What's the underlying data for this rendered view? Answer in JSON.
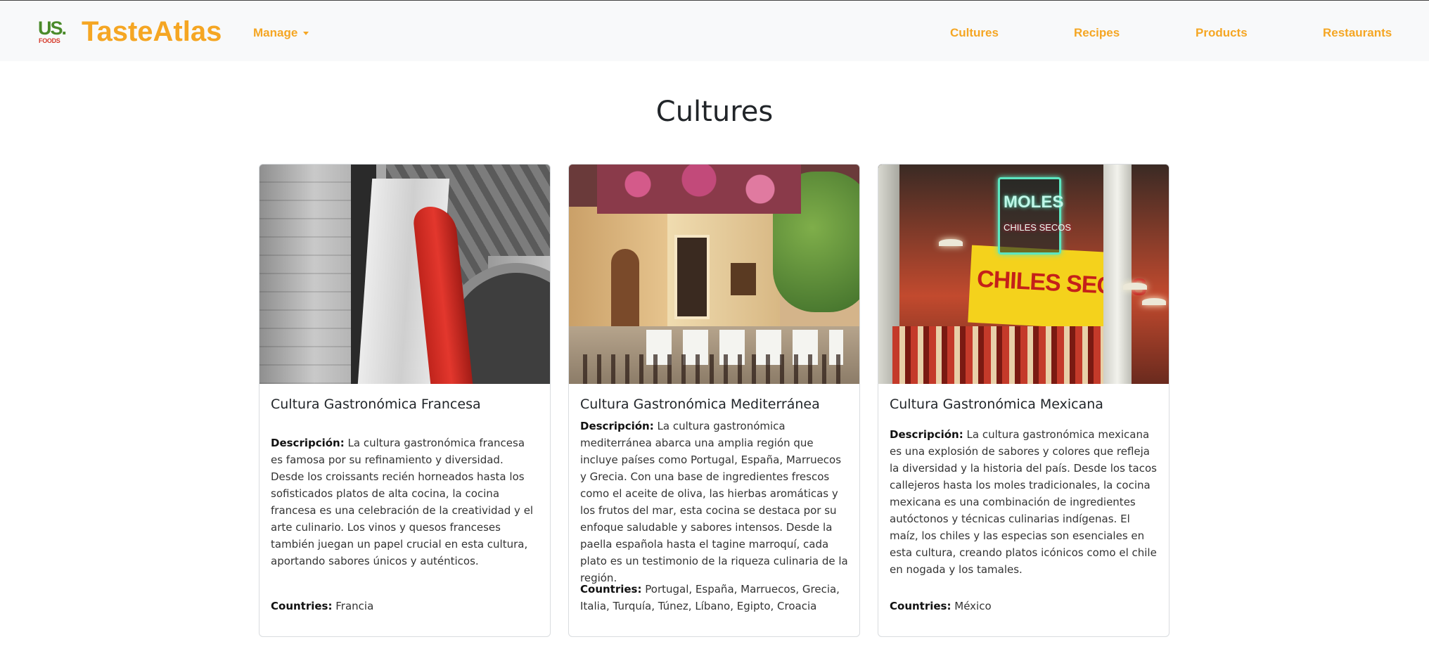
{
  "nav": {
    "logo_us": "US.",
    "logo_foods": "FOODS",
    "brand": "TasteAtlas",
    "manage": "Manage",
    "links": [
      "Cultures",
      "Recipes",
      "Products",
      "Restaurants"
    ]
  },
  "page": {
    "title": "Cultures"
  },
  "cards": [
    {
      "title": "Cultura Gastronómica Francesa",
      "desc_label": "Descripción:",
      "desc": "La cultura gastronómica francesa es famosa por su refinamiento y diversidad. Desde los croissants recién horneados hasta los sofisticados platos de alta cocina, la cocina francesa es una celebración de la creatividad y el arte culinario. Los vinos y quesos franceses también juegan un papel crucial en esta cultura, aportando sabores únicos y auténticos.",
      "countries_label": "Countries:",
      "countries": "Francia"
    },
    {
      "title": "Cultura Gastronómica Mediterránea",
      "desc_label": "Descripción:",
      "desc": "La cultura gastronómica mediterránea abarca una amplia región que incluye países como Portugal, España, Marruecos y Grecia. Con una base de ingredientes frescos como el aceite de oliva, las hierbas aromáticas y los frutos del mar, esta cocina se destaca por su enfoque saludable y sabores intensos. Desde la paella española hasta el tagine marroquí, cada plato es un testimonio de la riqueza culinaria de la región.",
      "countries_label": "Countries:",
      "countries": "Portugal, España, Marruecos, Grecia, Italia, Turquía, Túnez, Líbano, Egipto, Croacia"
    },
    {
      "title": "Cultura Gastronómica Mexicana",
      "desc_label": "Descripción:",
      "desc": "La cultura gastronómica mexicana es una explosión de sabores y colores que refleja la diversidad y la historia del país. Desde los tacos callejeros hasta los moles tradicionales, la cocina mexicana es una combinación de ingredientes autóctonos y técnicas culinarias indígenas. El maíz, los chiles y las especias son esenciales en esta cultura, creando platos icónicos como el chile en nogada y los tamales.",
      "countries_label": "Countries:",
      "countries": "México",
      "image_text_1": "MOLES",
      "image_text_2": "CHILES SECOS",
      "image_text_3": "CHILES SECOS"
    }
  ],
  "colors": {
    "accent": "#f5a623",
    "navbar_bg": "#f8f9fa",
    "card_border": "#d9dcdf"
  }
}
